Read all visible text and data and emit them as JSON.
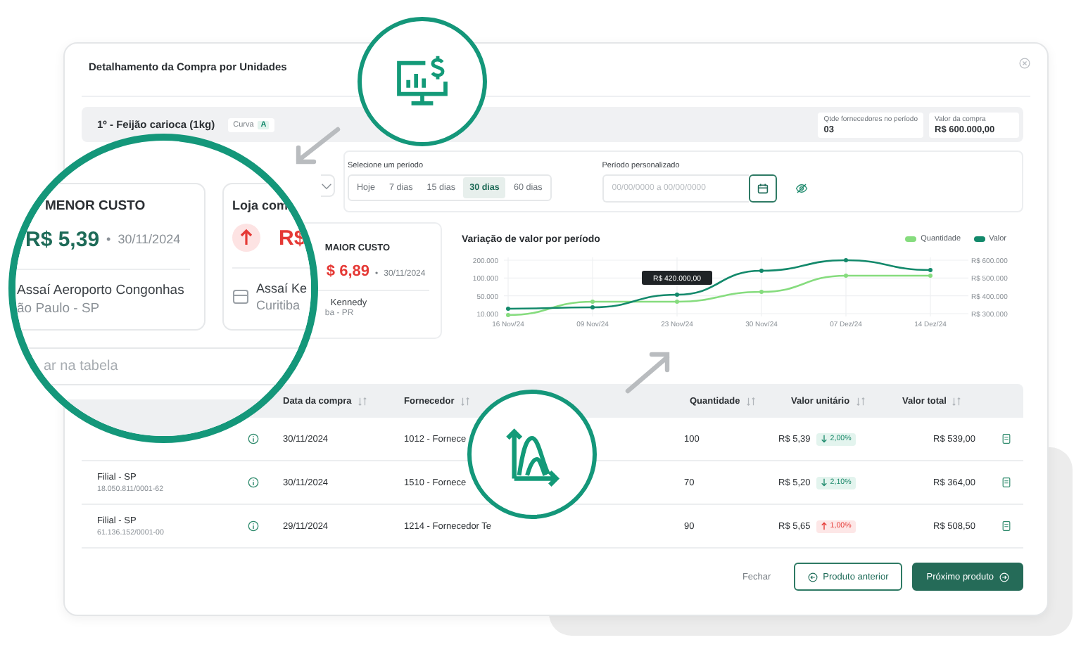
{
  "window": {
    "title": "Detalhamento da Compra por Unidades"
  },
  "product": {
    "name": "1º - Feijão carioca (1kg)",
    "curve_label": "Curva",
    "curve": "A",
    "stats": [
      {
        "label": "Qtde fornecedores no período",
        "value": "03"
      },
      {
        "label": "Valor da compra",
        "value": "R$ 600.000,00"
      }
    ]
  },
  "period": {
    "label": "Selecione um período",
    "options": [
      {
        "label": "Hoje",
        "selected": false
      },
      {
        "label": "7 dias",
        "selected": false
      },
      {
        "label": "15 dias",
        "selected": false
      },
      {
        "label": "30 dias",
        "selected": true
      },
      {
        "label": "60 dias",
        "selected": false
      }
    ],
    "custom_label": "Período personalizado",
    "custom_placeholder": "00/00/0000 a 00/00/0000"
  },
  "max_cost_card": {
    "title": "MAIOR CUSTO",
    "price": "$ 6,89",
    "separator": "•",
    "date": "30/11/2024",
    "store": "Kennedy",
    "city": "ba - PR"
  },
  "chart": {
    "title": "Variação de valor por período",
    "legend": [
      {
        "name": "Quantidade",
        "color": "#86dc7e"
      },
      {
        "name": "Valor",
        "color": "#13896b"
      }
    ],
    "y_labels": [
      "200.000",
      "100.000",
      "50.000",
      "10.000"
    ],
    "y2_labels": [
      "R$ 600.000",
      "R$ 500.000",
      "R$ 400.000",
      "R$ 300.000"
    ],
    "x_labels": [
      "16 Nov/24",
      "09 Nov/24",
      "23 Nov/24",
      "30 Nov/24",
      "07 Dez/24",
      "14 Dez/24"
    ],
    "tooltip": "R$ 420.000,00"
  },
  "table": {
    "columns": [
      "Data da compra",
      "Fornecedor",
      "Quantidade",
      "Valor unitário",
      "Valor total"
    ],
    "rows": [
      {
        "date": "30/11/2024",
        "supplier": "1012 - Fornece",
        "quantity": "100",
        "unit_price": "R$ 5,39",
        "change": {
          "up": false,
          "value": "2,00%"
        },
        "total": "R$ 539,00"
      },
      {
        "branch": "Filial - SP",
        "cnpj": "18.050.811/0001-62",
        "date": "30/11/2024",
        "supplier": "1510 - Fornece",
        "quantity": "70",
        "unit_price": "R$ 5,20",
        "change": {
          "up": false,
          "value": "2,10%"
        },
        "total": "R$ 364,00"
      },
      {
        "branch": "Filial - SP",
        "cnpj": "61.136.152/0001-00",
        "date": "29/11/2024",
        "supplier": "1214 - Fornecedor Te",
        "quantity": "90",
        "unit_price": "R$ 5,65",
        "change": {
          "up": true,
          "value": "1,00%"
        },
        "total": "R$ 508,50"
      }
    ]
  },
  "footer": {
    "buttons": [
      {
        "label": "Fechar",
        "kind": "text"
      },
      {
        "label": "Produto anterior",
        "kind": "outline"
      },
      {
        "label": "Próximo produto",
        "kind": "primary"
      }
    ]
  },
  "magnifier": {
    "min_card": {
      "title": "MENOR CUSTO",
      "price": "R$ 5,39",
      "separator": "•",
      "date": "30/11/2024",
      "store": "Assaí Aeroporto Congonhas",
      "city": "ão Paulo - SP"
    },
    "max_card": {
      "title": "Loja com",
      "price": "R$",
      "store": "Assaí Ke",
      "city": "Curitiba"
    },
    "search_placeholder": "ar na tabela"
  }
}
